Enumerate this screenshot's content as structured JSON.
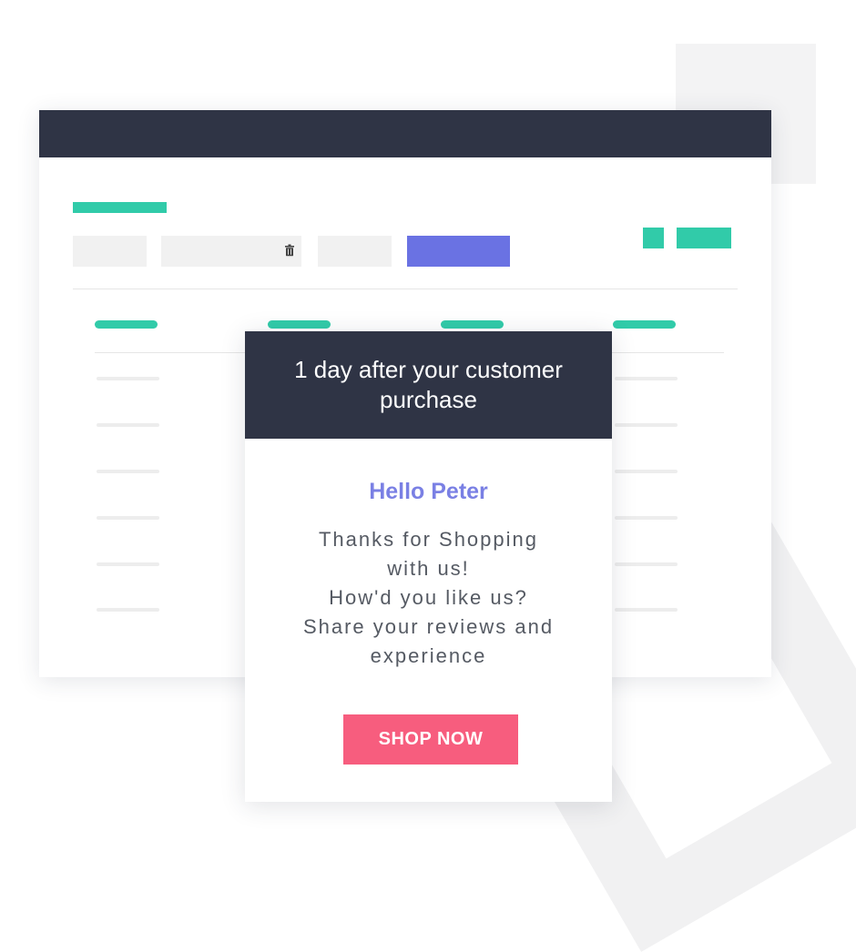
{
  "popup": {
    "title": "1 day after your  customer\npurchase",
    "greeting": "Hello Peter",
    "message": "Thanks for Shopping\nwith us!\nHow'd you like us?\nShare your reviews and\nexperience",
    "cta_label": "SHOP NOW"
  },
  "colors": {
    "dark": "#2f3445",
    "accent_green": "#31cba9",
    "accent_purple": "#6a72e3",
    "greeting": "#7a80e4",
    "cta": "#f75d7e"
  },
  "icons": {
    "filter_field": "trash-icon"
  }
}
